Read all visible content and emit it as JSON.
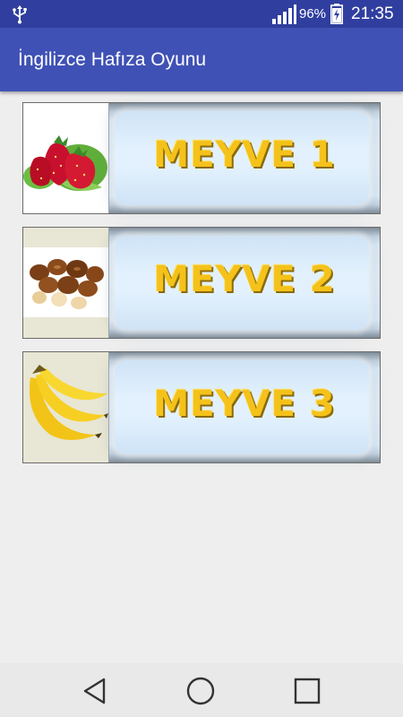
{
  "status_bar": {
    "battery_percent": "96%",
    "time": "21:35",
    "icons": [
      "usb-icon",
      "signal-icon",
      "battery-charging-icon"
    ]
  },
  "app_bar": {
    "title": "İngilizce Hafıza Oyunu"
  },
  "categories": [
    {
      "label": "MEYVE 1",
      "image": "strawberries"
    },
    {
      "label": "MEYVE 2",
      "image": "hazelnuts"
    },
    {
      "label": "MEYVE 3",
      "image": "bananas"
    }
  ],
  "nav_bar": {
    "buttons": [
      "back-button",
      "home-button",
      "recents-button"
    ]
  },
  "colors": {
    "status_bar": "#303f9f",
    "app_bar": "#3f51b5",
    "background": "#eeeeee",
    "label_text": "#f4c21a"
  }
}
